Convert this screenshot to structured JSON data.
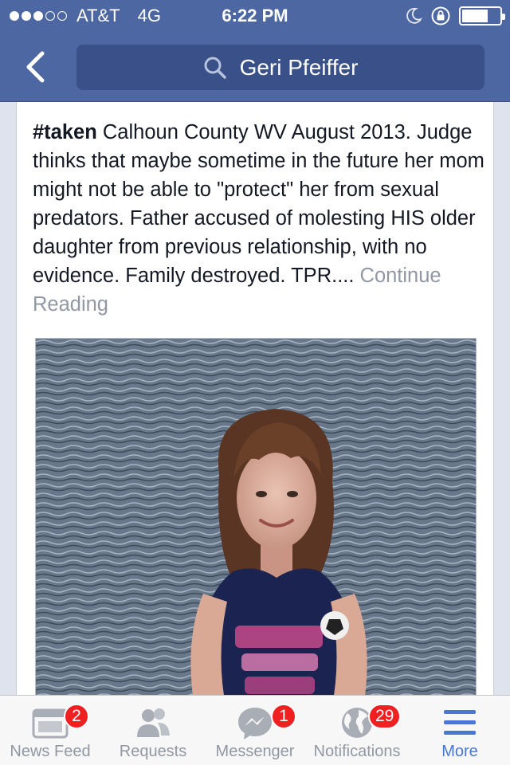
{
  "status_bar": {
    "carrier": "AT&T",
    "network": "4G",
    "time": "6:22 PM"
  },
  "header": {
    "search_text": "Geri Pfeiffer"
  },
  "post": {
    "hashtag": "#taken",
    "body": " Calhoun County WV August 2013. Judge thinks that maybe sometime in the future her mom might not be able to \"protect\" her from sexual predators. Father accused of molesting HIS older daughter from previous relationship, with no evidence. Family destroyed. TPR.... ",
    "continue_label": "Continue Reading"
  },
  "tab_bar": {
    "tabs": [
      {
        "label": "News Feed",
        "icon": "news-feed-icon",
        "badge": "2"
      },
      {
        "label": "Requests",
        "icon": "friend-requests-icon",
        "badge": ""
      },
      {
        "label": "Messenger",
        "icon": "messenger-icon",
        "badge": "1"
      },
      {
        "label": "Notifications",
        "icon": "globe-icon",
        "badge": "29"
      },
      {
        "label": "More",
        "icon": "menu-icon",
        "badge": ""
      }
    ],
    "active_tab": "More"
  },
  "colors": {
    "header_blue": "#4d67a2",
    "search_blue": "#3a5089",
    "active_tab": "#4a77d4",
    "badge_red": "#f02020"
  }
}
